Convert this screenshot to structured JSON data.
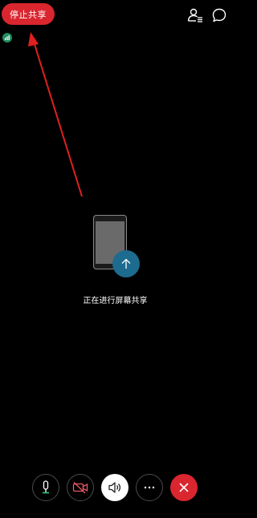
{
  "header": {
    "stop_share_label": "停止共享",
    "icons": [
      "signal-icon",
      "participants-icon",
      "chat-icon"
    ]
  },
  "share": {
    "status_text": "正在进行屏幕共享",
    "icons": [
      "phone-icon",
      "share-upload-icon"
    ]
  },
  "controls": [
    {
      "name": "mute-button",
      "icon": "microphone-icon"
    },
    {
      "name": "video-button",
      "icon": "video-off-icon"
    },
    {
      "name": "audio-button",
      "icon": "speaker-icon"
    },
    {
      "name": "more-button",
      "icon": "more-icon"
    },
    {
      "name": "end-button",
      "icon": "close-icon"
    }
  ],
  "colors": {
    "background": "#000000",
    "stop_button": "#d9262f",
    "signal": "#1f8f60",
    "share_circle": "#1d6b8e",
    "arrow": "#e02020"
  }
}
